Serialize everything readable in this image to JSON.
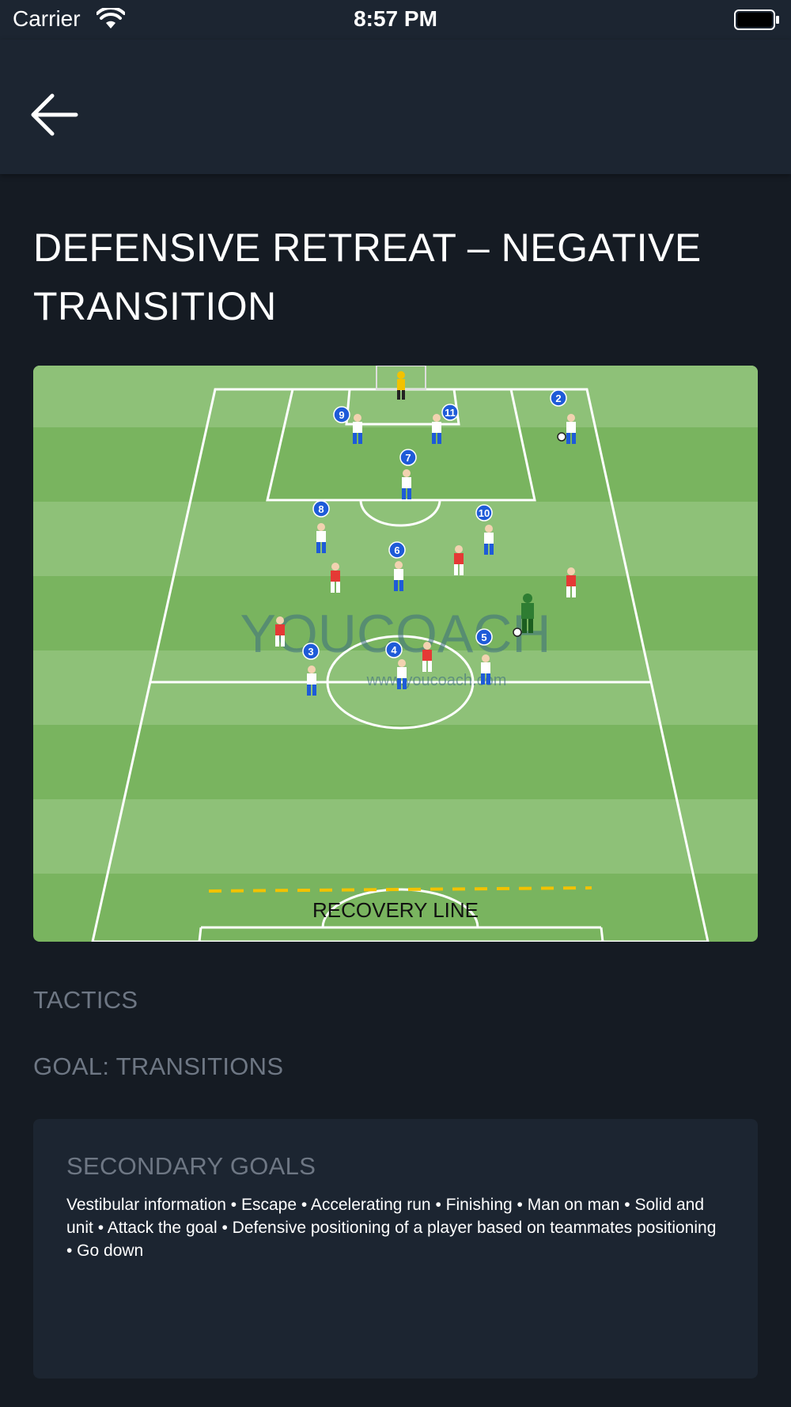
{
  "status_bar": {
    "carrier": "Carrier",
    "time": "8:57 PM"
  },
  "page": {
    "title": "DEFENSIVE RETREAT – NEGATIVE TRANSITION"
  },
  "drill_image": {
    "watermark": "YOUCOACH",
    "watermark_url": "www.youcoach.com",
    "recovery_line_label": "RECOVERY LINE",
    "player_numbers": [
      "2",
      "3",
      "4",
      "5",
      "6",
      "7",
      "8",
      "9",
      "10",
      "11"
    ]
  },
  "details": {
    "category": "TACTICS",
    "goal": "GOAL: TRANSITIONS",
    "secondary_goals_title": "SECONDARY GOALS",
    "secondary_goals_text": "Vestibular information • Escape • Accelerating run • Finishing • Man on man • Solid and unit • Attack the goal • Defensive positioning of a player based on teammates positioning • Go down"
  },
  "colors": {
    "background": "#151b23",
    "bar": "#1c2531",
    "muted_text": "#6e7784",
    "pitch_light": "#8ec178",
    "pitch_dark": "#79b45f",
    "team_white": "#ffffff",
    "team_red": "#e53935",
    "marker_blue": "#1e5bd8",
    "recovery_dash": "#f2c200"
  },
  "icons": {
    "back": "arrow-left-icon",
    "wifi": "wifi-icon",
    "battery": "battery-icon"
  }
}
